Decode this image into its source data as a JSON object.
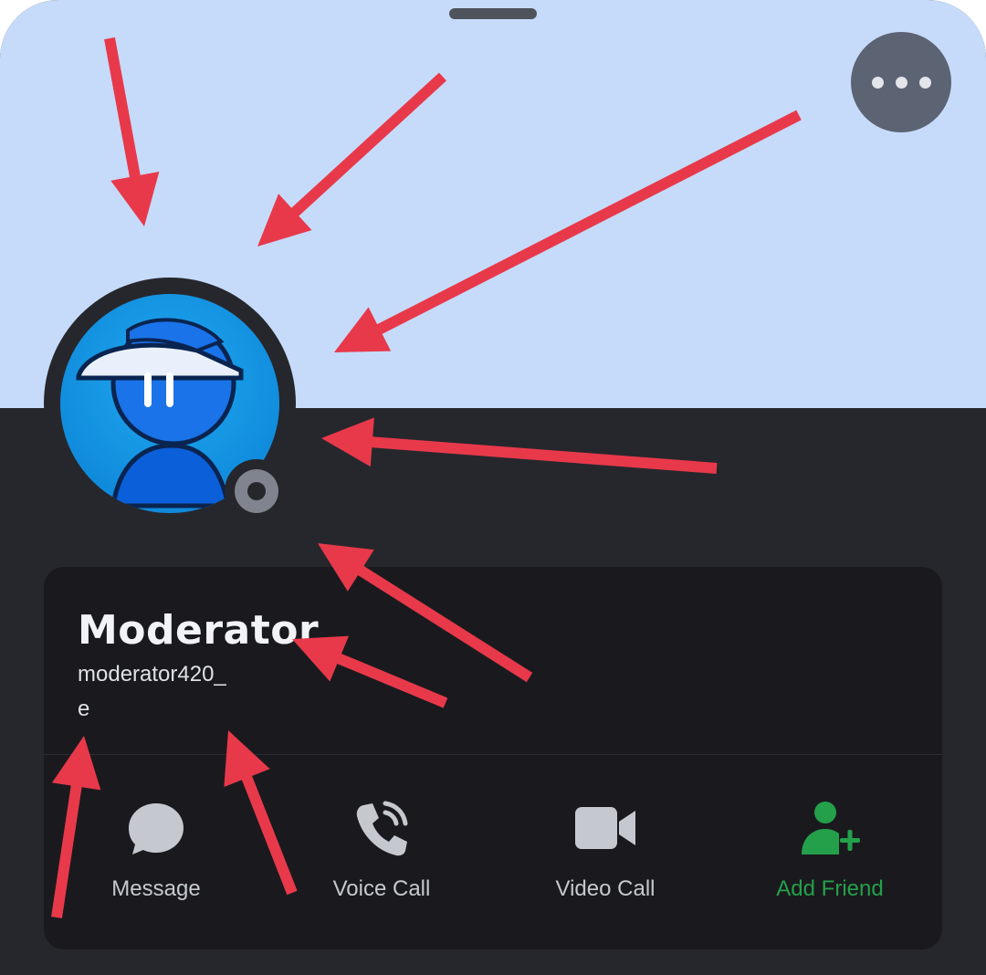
{
  "profile": {
    "display_name": "Moderator",
    "username_line1": "moderator420_",
    "username_line2": "e",
    "status": "offline",
    "banner_color": "#c6dbfa"
  },
  "header": {
    "more_icon": "more-horizontal-icon"
  },
  "actions": [
    {
      "label": "Message",
      "icon": "chat-bubble-icon"
    },
    {
      "label": "Voice Call",
      "icon": "phone-call-icon"
    },
    {
      "label": "Video Call",
      "icon": "video-camera-icon"
    },
    {
      "label": "Add Friend",
      "icon": "add-friend-icon",
      "color": "#24a04a"
    }
  ],
  "annotations": {
    "arrow_color": "#e8394a",
    "arrow_count": 8
  }
}
